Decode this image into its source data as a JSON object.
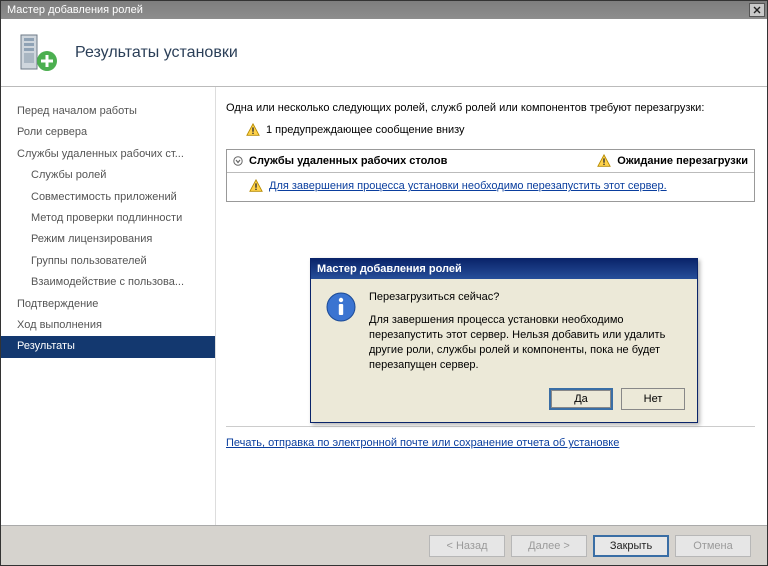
{
  "window": {
    "title": "Мастер добавления ролей"
  },
  "header": {
    "page_title": "Результаты установки"
  },
  "sidebar": {
    "items": [
      {
        "label": "Перед началом работы"
      },
      {
        "label": "Роли сервера"
      },
      {
        "label": "Службы удаленных рабочих ст..."
      },
      {
        "label": "Службы ролей",
        "sub": true
      },
      {
        "label": "Совместимость приложений",
        "sub": true
      },
      {
        "label": "Метод проверки подлинности",
        "sub": true
      },
      {
        "label": "Режим лицензирования",
        "sub": true
      },
      {
        "label": "Группы пользователей",
        "sub": true
      },
      {
        "label": "Взаимодействие с пользова...",
        "sub": true
      },
      {
        "label": "Подтверждение"
      },
      {
        "label": "Ход выполнения"
      },
      {
        "label": "Результаты",
        "active": true
      }
    ]
  },
  "content": {
    "intro": "Одна или несколько следующих ролей, служб ролей или компонентов требуют перезагрузки:",
    "warning_count": "1 предупреждающее сообщение внизу",
    "status": {
      "title": "Службы удаленных рабочих столов",
      "state": "Ожидание перезагрузки",
      "message": "Для завершения процесса установки необходимо перезапустить этот сервер."
    },
    "report_link": "Печать, отправка по электронной почте или сохранение отчета об установке"
  },
  "footer": {
    "back": "< Назад",
    "next": "Далее >",
    "close": "Закрыть",
    "cancel": "Отмена"
  },
  "dialog": {
    "title": "Мастер добавления ролей",
    "question": "Перезагрузиться сейчас?",
    "body": "Для завершения процесса установки необходимо перезапустить этот сервер. Нельзя добавить или удалить другие роли, службы ролей и компоненты, пока не будет перезапущен сервер.",
    "yes": "Да",
    "no": "Нет"
  }
}
